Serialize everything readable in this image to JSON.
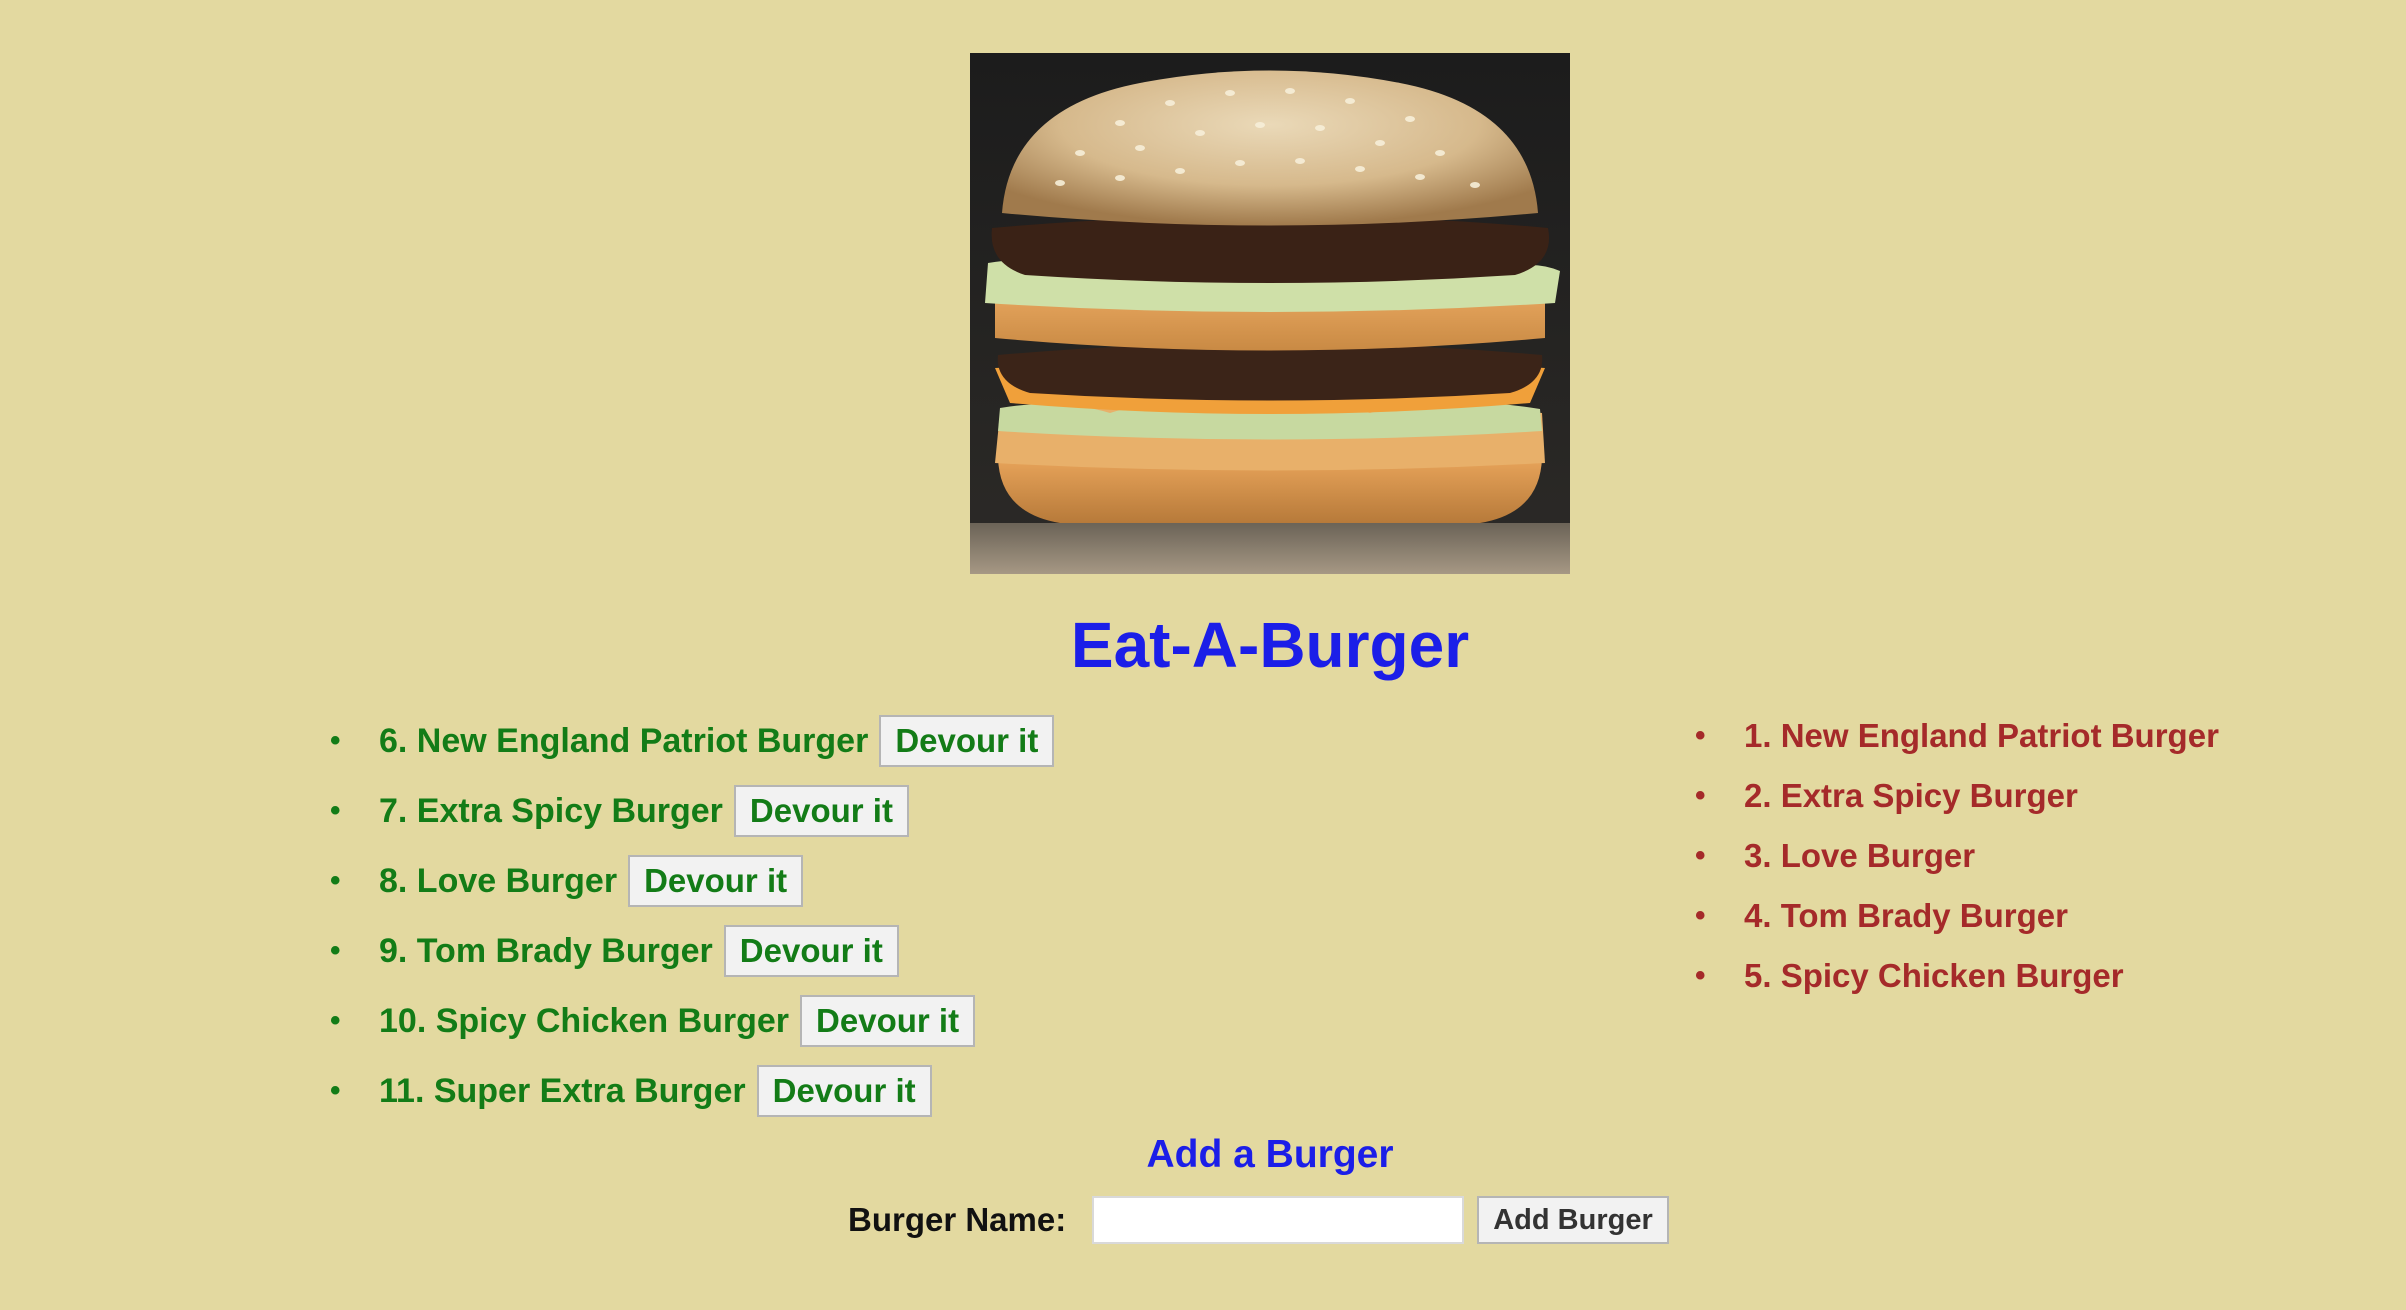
{
  "image": {
    "icon": "burger-photo"
  },
  "title": "Eat-A-Burger",
  "bullet": "•",
  "uneaten": [
    {
      "label": "6. New England Patriot Burger",
      "button": "Devour it"
    },
    {
      "label": "7. Extra Spicy Burger",
      "button": "Devour it"
    },
    {
      "label": "8. Love Burger",
      "button": "Devour it"
    },
    {
      "label": "9. Tom Brady Burger",
      "button": "Devour it"
    },
    {
      "label": "10. Spicy Chicken Burger",
      "button": "Devour it"
    },
    {
      "label": "11. Super Extra Burger",
      "button": "Devour it"
    }
  ],
  "devoured": [
    {
      "label": "1. New England Patriot Burger"
    },
    {
      "label": "2. Extra Spicy Burger"
    },
    {
      "label": "3. Love Burger"
    },
    {
      "label": "4. Tom Brady Burger"
    },
    {
      "label": "5. Spicy Chicken Burger"
    }
  ],
  "form": {
    "heading": "Add a Burger",
    "label": "Burger Name:",
    "input_value": "",
    "button": "Add Burger"
  },
  "colors": {
    "background": "#e3d9a0",
    "title": "#1b1ee8",
    "uneaten": "#137c17",
    "devoured": "#a52a2a"
  }
}
